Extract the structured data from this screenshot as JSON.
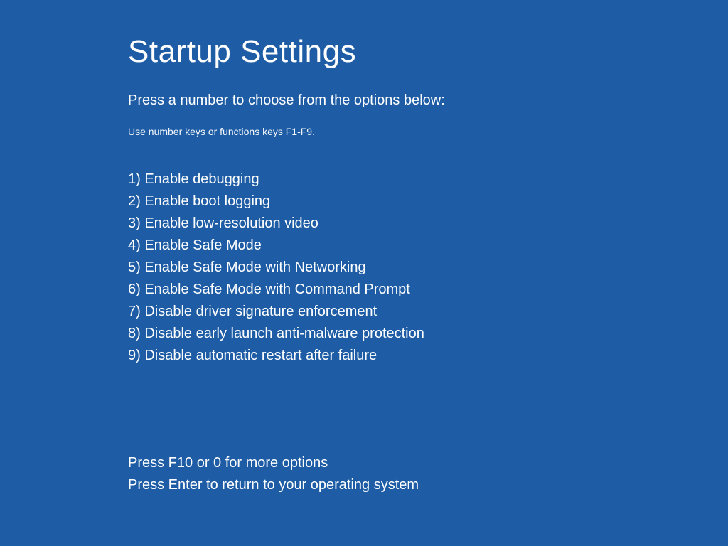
{
  "title": "Startup Settings",
  "subtitle": "Press a number to choose from the options below:",
  "hint": "Use number keys or functions keys F1-F9.",
  "options": [
    "1) Enable debugging",
    "2) Enable boot logging",
    "3) Enable low-resolution video",
    "4) Enable Safe Mode",
    "5) Enable Safe Mode with Networking",
    "6) Enable Safe Mode with Command Prompt",
    "7) Disable driver signature enforcement",
    "8) Disable early launch anti-malware protection",
    "9) Disable automatic restart after failure"
  ],
  "footer": {
    "more_options": "Press F10 or 0 for more options",
    "return": "Press Enter to return to your operating system"
  }
}
